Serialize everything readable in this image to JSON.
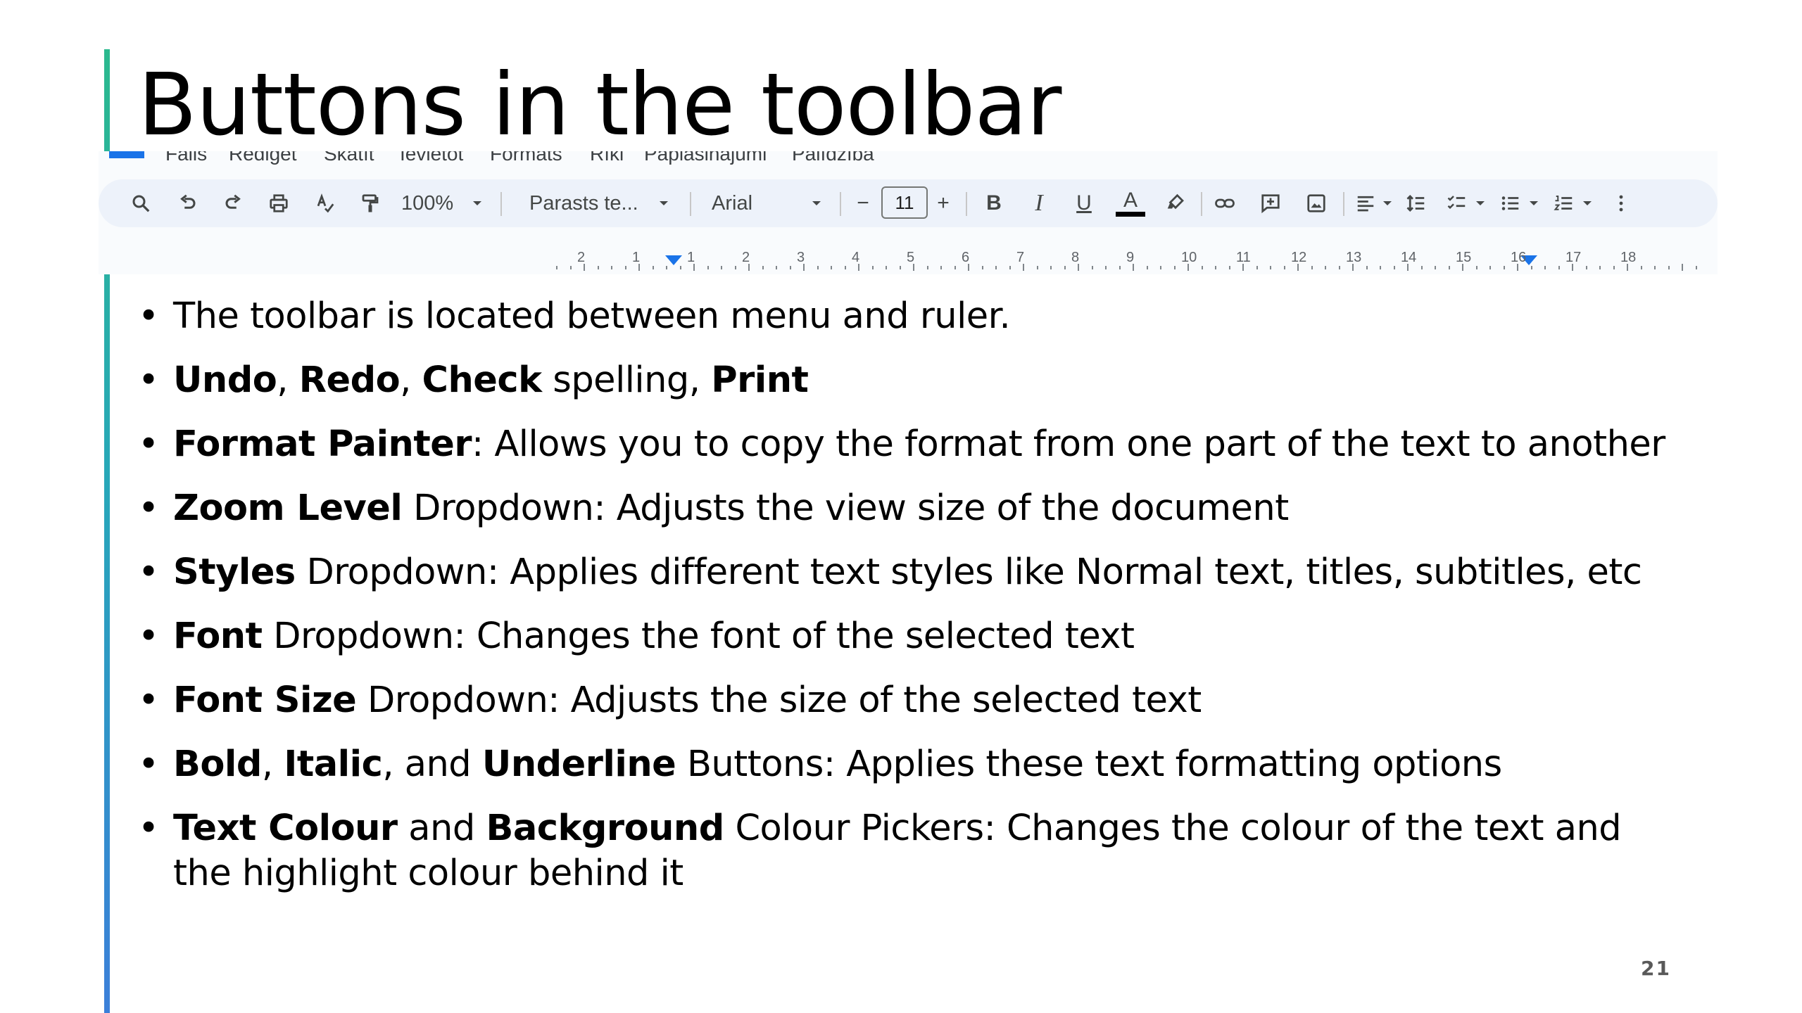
{
  "slide": {
    "title": "Buttons in the toolbar",
    "page_number": "21",
    "accent_colors": [
      "#2bb98e",
      "#3b7fd9"
    ]
  },
  "screenshot": {
    "menu": [
      "Fails",
      "Rediģēt",
      "Skatīt",
      "Ievietot",
      "Formāts",
      "Rīki",
      "Paplašinājumi",
      "Palīdzība"
    ],
    "toolbar": {
      "zoom": "100%",
      "style": "Parasts te...",
      "font": "Arial",
      "font_size": "11",
      "icons": [
        "search-icon",
        "undo-icon",
        "redo-icon",
        "print-icon",
        "spellcheck-icon",
        "paint-format-icon",
        "bold-icon",
        "italic-icon",
        "underline-icon",
        "text-color-icon",
        "highlight-icon",
        "link-icon",
        "comment-icon",
        "image-icon",
        "align-icon",
        "line-spacing-icon",
        "checklist-icon",
        "bulleted-list-icon",
        "numbered-list-icon",
        "more-icon"
      ],
      "bold": "B",
      "italic": "I",
      "underline": "U",
      "text_color": "A",
      "minus": "−",
      "plus": "+"
    },
    "ruler": [
      "2",
      "1",
      "1",
      "2",
      "3",
      "4",
      "5",
      "6",
      "7",
      "8",
      "9",
      "10",
      "11",
      "12",
      "13",
      "14",
      "15",
      "16",
      "17",
      "18"
    ],
    "accent_blue": "#1a73e8"
  },
  "bullets": [
    [
      {
        "t": "The toolbar is located between menu and ruler.",
        "b": false
      }
    ],
    [
      {
        "t": "Undo",
        "b": true
      },
      {
        "t": ", ",
        "b": false
      },
      {
        "t": "Redo",
        "b": true
      },
      {
        "t": ", ",
        "b": false
      },
      {
        "t": "Check",
        "b": true
      },
      {
        "t": " spelling, ",
        "b": false
      },
      {
        "t": "Print",
        "b": true
      }
    ],
    [
      {
        "t": "Format Painter",
        "b": true
      },
      {
        "t": ": Allows you to copy the format from one part of the text to another",
        "b": false
      }
    ],
    [
      {
        "t": "Zoom Level",
        "b": true
      },
      {
        "t": " Dropdown: Adjusts the view size of the document",
        "b": false
      }
    ],
    [
      {
        "t": "Styles",
        "b": true
      },
      {
        "t": " Dropdown: Applies different text styles like Normal text, titles, subtitles, etc",
        "b": false
      }
    ],
    [
      {
        "t": "Font",
        "b": true
      },
      {
        "t": " Dropdown: Changes the font of the selected text",
        "b": false
      }
    ],
    [
      {
        "t": "Font Size",
        "b": true
      },
      {
        "t": " Dropdown: Adjusts the size of the selected text",
        "b": false
      }
    ],
    [
      {
        "t": "Bold",
        "b": true
      },
      {
        "t": ", ",
        "b": false
      },
      {
        "t": "Italic",
        "b": true
      },
      {
        "t": ", and ",
        "b": false
      },
      {
        "t": "Underline",
        "b": true
      },
      {
        "t": " Buttons: Applies these text formatting options",
        "b": false
      }
    ],
    [
      {
        "t": "Text Colour",
        "b": true
      },
      {
        "t": " and ",
        "b": false
      },
      {
        "t": "Background",
        "b": true
      },
      {
        "t": " Colour Pickers: Changes the colour of the text and the highlight colour behind it",
        "b": false
      }
    ]
  ]
}
